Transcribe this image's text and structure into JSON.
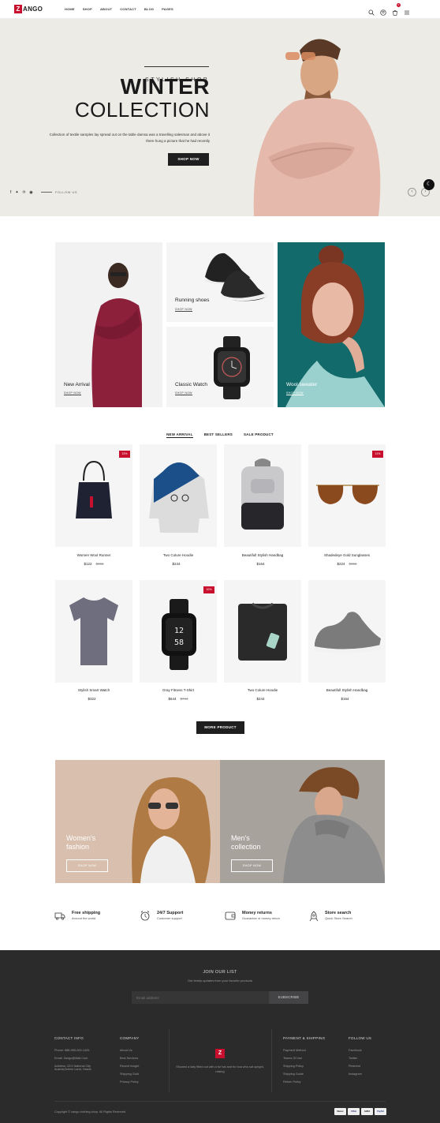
{
  "header": {
    "logo_letter": "Z",
    "logo_text": "ANGO",
    "nav": [
      "HOME",
      "SHOP",
      "ABOUT",
      "CONTACT",
      "BLOG",
      "PAGES"
    ],
    "cart_count": "0"
  },
  "hero": {
    "eyebrow": "STYLISH SHOP",
    "title_line1": "WINTER",
    "title_line2": "COLLECTION",
    "description": "Collection of textile samples lay spread out on the table damsa was a travelling salesman and above it there hung a picture that he had recently",
    "button": "SHOP NOW",
    "follow": "FOLLOW US",
    "social_icons": [
      "facebook-icon",
      "twitter-icon",
      "pinterest-icon",
      "github-icon"
    ]
  },
  "categories": [
    {
      "label": "New Arrival",
      "link": "SHOP NOW"
    },
    {
      "label": "Running shoes",
      "link": "SHOP NOW"
    },
    {
      "label": "Classic Watch",
      "link": "SHOP NOW"
    },
    {
      "label": "Wool sweater",
      "link": "SHOP NOW"
    }
  ],
  "tabs": [
    "NEW ARRIVAL",
    "BEST SELLERS",
    "SALE PRODUCT"
  ],
  "products": [
    {
      "name": "Women Wool Runner",
      "price": "$122",
      "old": "$255",
      "badge": "13%"
    },
    {
      "name": "Two Colure Hoodie",
      "price": "$244",
      "old": "",
      "badge": ""
    },
    {
      "name": "Beautifull Stylish Handbag",
      "price": "$164",
      "old": "",
      "badge": ""
    },
    {
      "name": "Shadedeye Gold Sunglasses",
      "price": "$224",
      "old": "$355",
      "badge": "11%"
    },
    {
      "name": "Stylish Smart Watch",
      "price": "$322",
      "old": "",
      "badge": ""
    },
    {
      "name": "Gray Fitness T-Shirt",
      "price": "$644",
      "old": "$744",
      "badge": "10%"
    },
    {
      "name": "Two Colure Hoodie",
      "price": "$244",
      "old": "",
      "badge": ""
    },
    {
      "name": "Beautifull Stylish Handbag",
      "price": "$164",
      "old": "",
      "badge": ""
    }
  ],
  "more_button": "MORE PRODUCT",
  "banners": [
    {
      "line1": "Women's",
      "line2": "fashion",
      "button": "SHOP NOW"
    },
    {
      "line1": "Men's",
      "line2": "collection",
      "button": "SHOP NOW"
    }
  ],
  "features": [
    {
      "title": "Free shipping",
      "sub": "Around the world",
      "icon": "truck-icon"
    },
    {
      "title": "24/7 Support",
      "sub": "Customer support",
      "icon": "clock-icon"
    },
    {
      "title": "Money returns",
      "sub": "Guarantee of money return",
      "icon": "wallet-icon"
    },
    {
      "title": "Store search",
      "sub": "Quick Store Search",
      "icon": "rocket-icon"
    }
  ],
  "newsletter": {
    "title": "JOIN OUR LIST",
    "sub": "Get timely updates from your favorite products",
    "placeholder": "Email address",
    "button": "SUBSCRIBE"
  },
  "footer": {
    "contact_title": "CONTACT INFO",
    "contact": [
      "Phone: 888-999-000-1425",
      "Email: Zango@Mail.Com",
      "Address: 22/1 National City Austria,Dreem Land, Hawai"
    ],
    "company_title": "COMPANY",
    "company": [
      "About Us",
      "Best Services",
      "Recent Insight",
      "Shipping Guid",
      "Privacy Policy"
    ],
    "about_logo": "Z",
    "about_text": "Showed a lady fitted out with a fur hat and fur boa who sat upright, raising",
    "payment_title": "PAYMENT & SHIPPING",
    "payment": [
      "Payment Method",
      "Teams Of Use",
      "Shipping Policy",
      "Shipping Guide",
      "Return Policy"
    ],
    "follow_title": "FOLLOW US",
    "follow": [
      "Facebook",
      "Twitter",
      "Pinterest",
      "Instagram"
    ],
    "copyright": "Copyright © zango clothing shop. All Rights Reserved",
    "cards": [
      "Master",
      "VISA",
      "AMEX",
      "PayPal"
    ]
  },
  "colors": {
    "accent": "#c8102e",
    "dark": "#1f1f1f",
    "hero_bg": "#ecebe6",
    "footer_bg": "#2b2b2c"
  }
}
